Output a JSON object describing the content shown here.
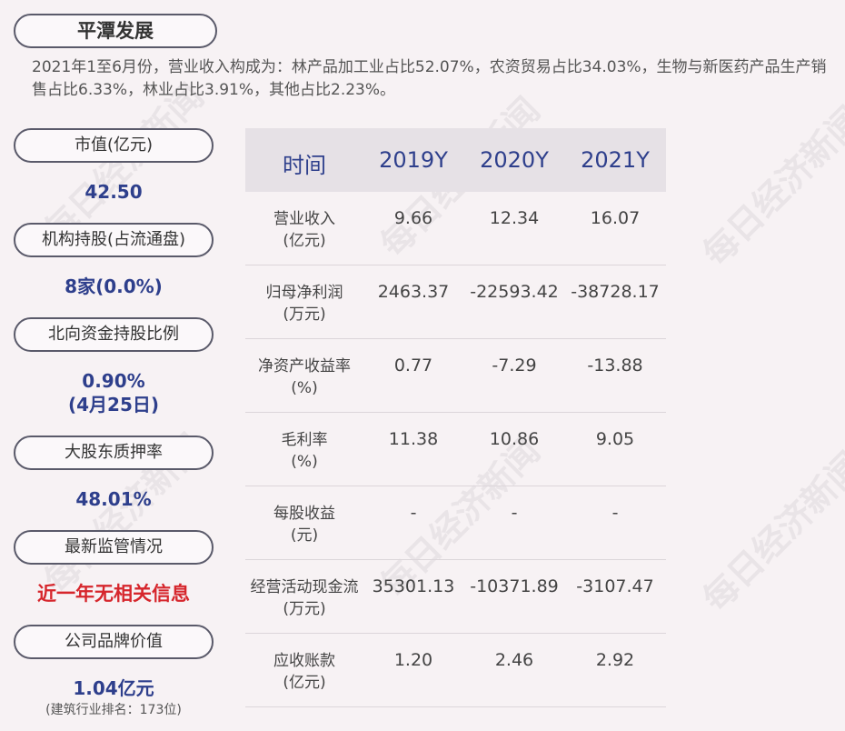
{
  "title": "平潭发展",
  "summary": "2021年1至6月份，营业收入构成为：林产品加工业占比52.07%，农资贸易占比34.03%，生物与新医药产品生产销售占比6.33%，林业占比3.91%，其他占比2.23%。",
  "metrics": {
    "market_cap": {
      "label": "市值(亿元)",
      "value": "42.50"
    },
    "institutions": {
      "label": "机构持股(占流通盘)",
      "value": "8家(0.0%)"
    },
    "northbound": {
      "label": "北向资金持股比例",
      "value": "0.90%",
      "date": "(4月25日)"
    },
    "pledge": {
      "label": "大股东质押率",
      "value": "48.01%"
    },
    "regulation": {
      "label": "最新监管情况",
      "value": "近一年无相关信息"
    },
    "brand": {
      "label": "公司品牌价值",
      "value": "1.04亿元",
      "note": "(建筑行业排名：173位)"
    }
  },
  "table": {
    "headers": [
      "时间",
      "2019Y",
      "2020Y",
      "2021Y"
    ],
    "rows": [
      {
        "label1": "营业收入",
        "label2": "(亿元)",
        "values": [
          "9.66",
          "12.34",
          "16.07"
        ]
      },
      {
        "label1": "归母净利润",
        "label2": "(万元)",
        "values": [
          "2463.37",
          "-22593.42",
          "-38728.17"
        ]
      },
      {
        "label1": "净资产收益率",
        "label2": "(%)",
        "values": [
          "0.77",
          "-7.29",
          "-13.88"
        ]
      },
      {
        "label1": "毛利率",
        "label2": "(%)",
        "values": [
          "11.38",
          "10.86",
          "9.05"
        ]
      },
      {
        "label1": "每股收益",
        "label2": "(元)",
        "values": [
          "-",
          "-",
          "-"
        ]
      },
      {
        "label1": "经营活动现金流",
        "label2": "(万元)",
        "values": [
          "35301.13",
          "-10371.89",
          "-3107.47"
        ]
      },
      {
        "label1": "应收账款",
        "label2": "(亿元)",
        "values": [
          "1.20",
          "2.46",
          "2.92"
        ]
      }
    ]
  },
  "watermark": "每日经济新闻"
}
